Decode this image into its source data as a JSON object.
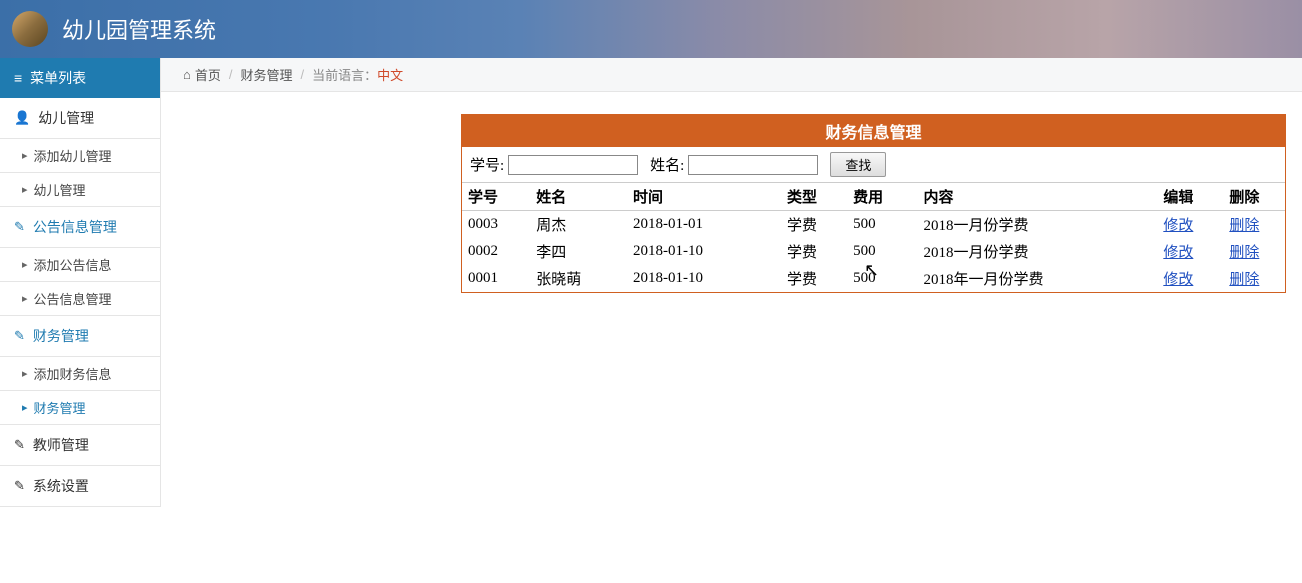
{
  "app": {
    "title": "幼儿园管理系统"
  },
  "menu": {
    "header": "菜单列表",
    "groups": [
      {
        "label": "幼儿管理",
        "icon": "user",
        "blue": false,
        "items": [
          "添加幼儿管理",
          "幼儿管理"
        ]
      },
      {
        "label": "公告信息管理",
        "icon": "edit",
        "blue": true,
        "items": [
          "添加公告信息",
          "公告信息管理"
        ]
      },
      {
        "label": "财务管理",
        "icon": "edit",
        "blue": true,
        "items": [
          "添加财务信息",
          "财务管理"
        ],
        "activeIndex": 1
      },
      {
        "label": "教师管理",
        "icon": "edit",
        "blue": false,
        "items": []
      },
      {
        "label": "系统设置",
        "icon": "edit",
        "blue": false,
        "items": []
      }
    ]
  },
  "breadcrumb": {
    "home": "首页",
    "section": "财务管理",
    "langLabel": "当前语言：",
    "langValue": "中文"
  },
  "panel": {
    "title": "财务信息管理",
    "search": {
      "idLabel": "学号:",
      "nameLabel": "姓名:",
      "button": "查找"
    },
    "columns": [
      "学号",
      "姓名",
      "时间",
      "类型",
      "费用",
      "内容",
      "编辑",
      "删除"
    ],
    "editLabel": "修改",
    "deleteLabel": "删除",
    "rows": [
      {
        "id": "0003",
        "name": "周杰",
        "time": "2018-01-01",
        "type": "学费",
        "fee": "500",
        "content": "2018一月份学费"
      },
      {
        "id": "0002",
        "name": "李四",
        "time": "2018-01-10",
        "type": "学费",
        "fee": "500",
        "content": "2018一月份学费"
      },
      {
        "id": "0001",
        "name": "张晓萌",
        "time": "2018-01-10",
        "type": "学费",
        "fee": "500",
        "content": "2018年一月份学费"
      }
    ]
  }
}
